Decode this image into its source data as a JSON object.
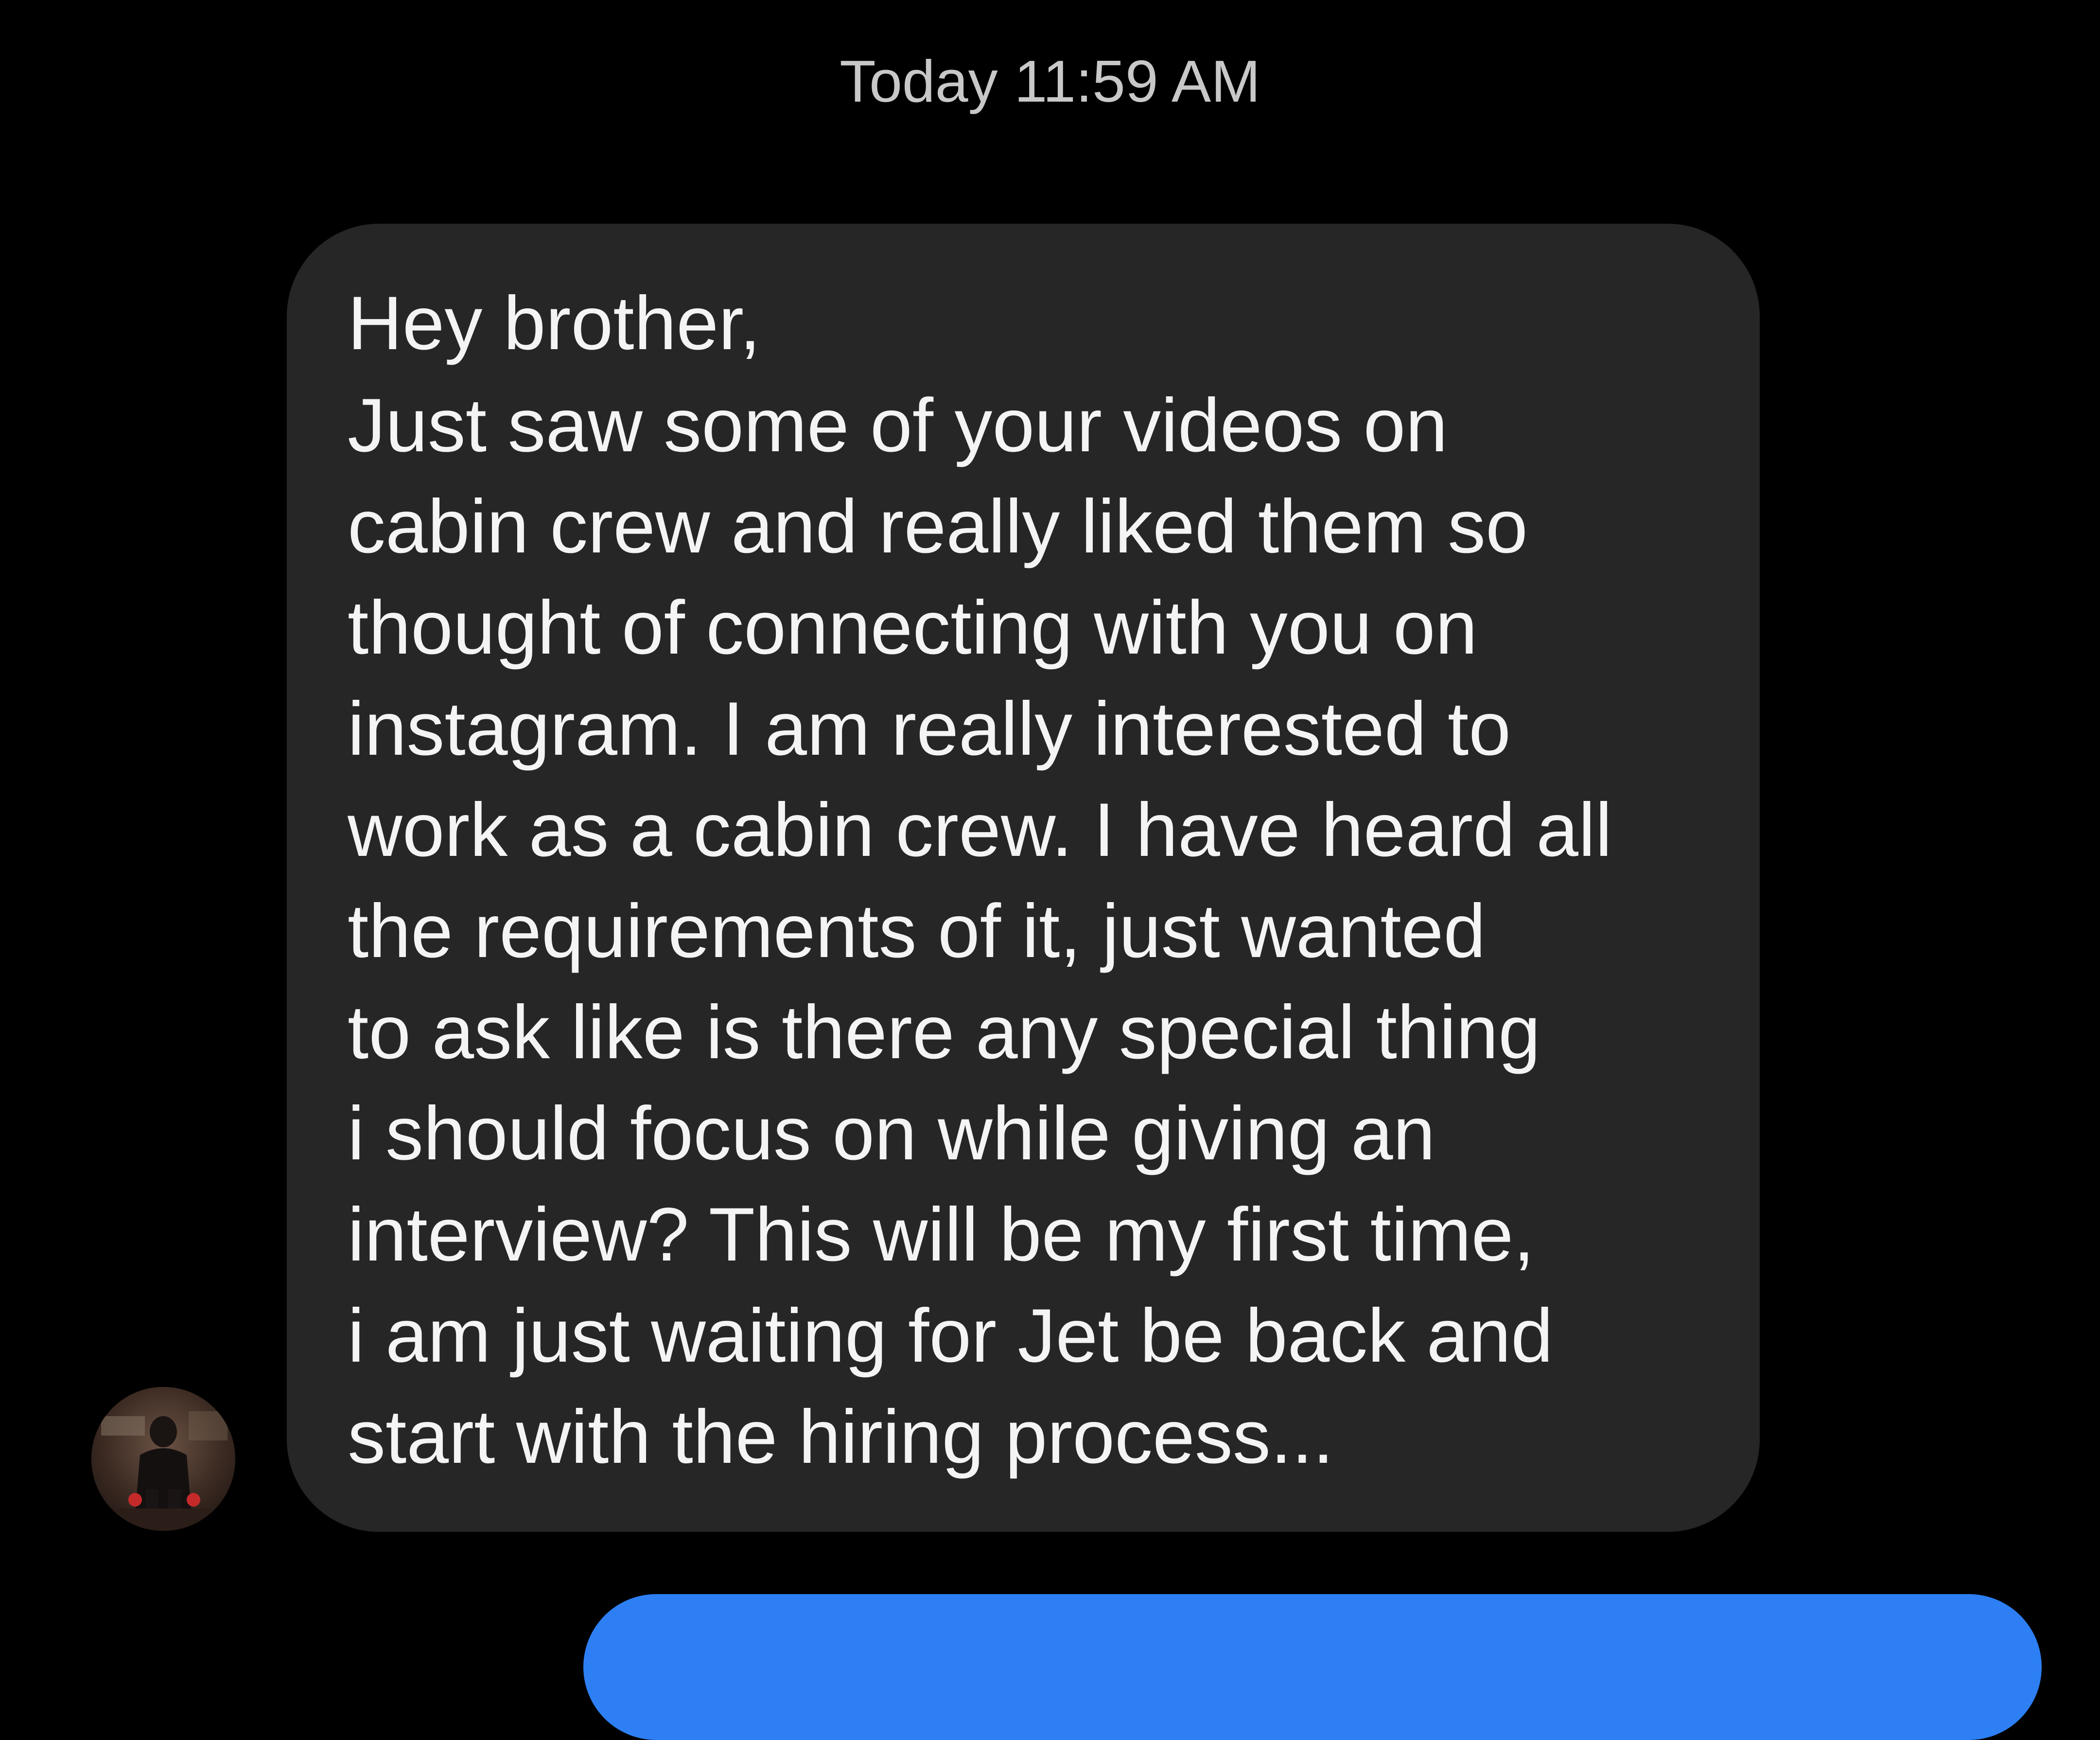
{
  "conversation": {
    "timestamp": "Today 11:59 AM",
    "incoming_message": {
      "lines": [
        "Hey brother,",
        "Just saw some of your videos on",
        "cabin crew and really liked them so",
        "thought of connecting with you on",
        "instagram. I am really interested to",
        "work as a cabin crew. I have heard all",
        "the requirements of it, just wanted",
        "to ask like is there any special thing",
        "i should focus on while giving an",
        "interview? This will be my first time,",
        "i am just waiting for Jet be back and",
        "start with the hiring process..."
      ]
    },
    "sender": {
      "avatar_icon": "profile-photo"
    },
    "colors": {
      "background": "#000000",
      "incoming_bubble": "#262626",
      "outgoing_bubble": "#2d7ff3",
      "timestamp_text": "#c8c8c8",
      "message_text": "#f4f4f4"
    }
  }
}
